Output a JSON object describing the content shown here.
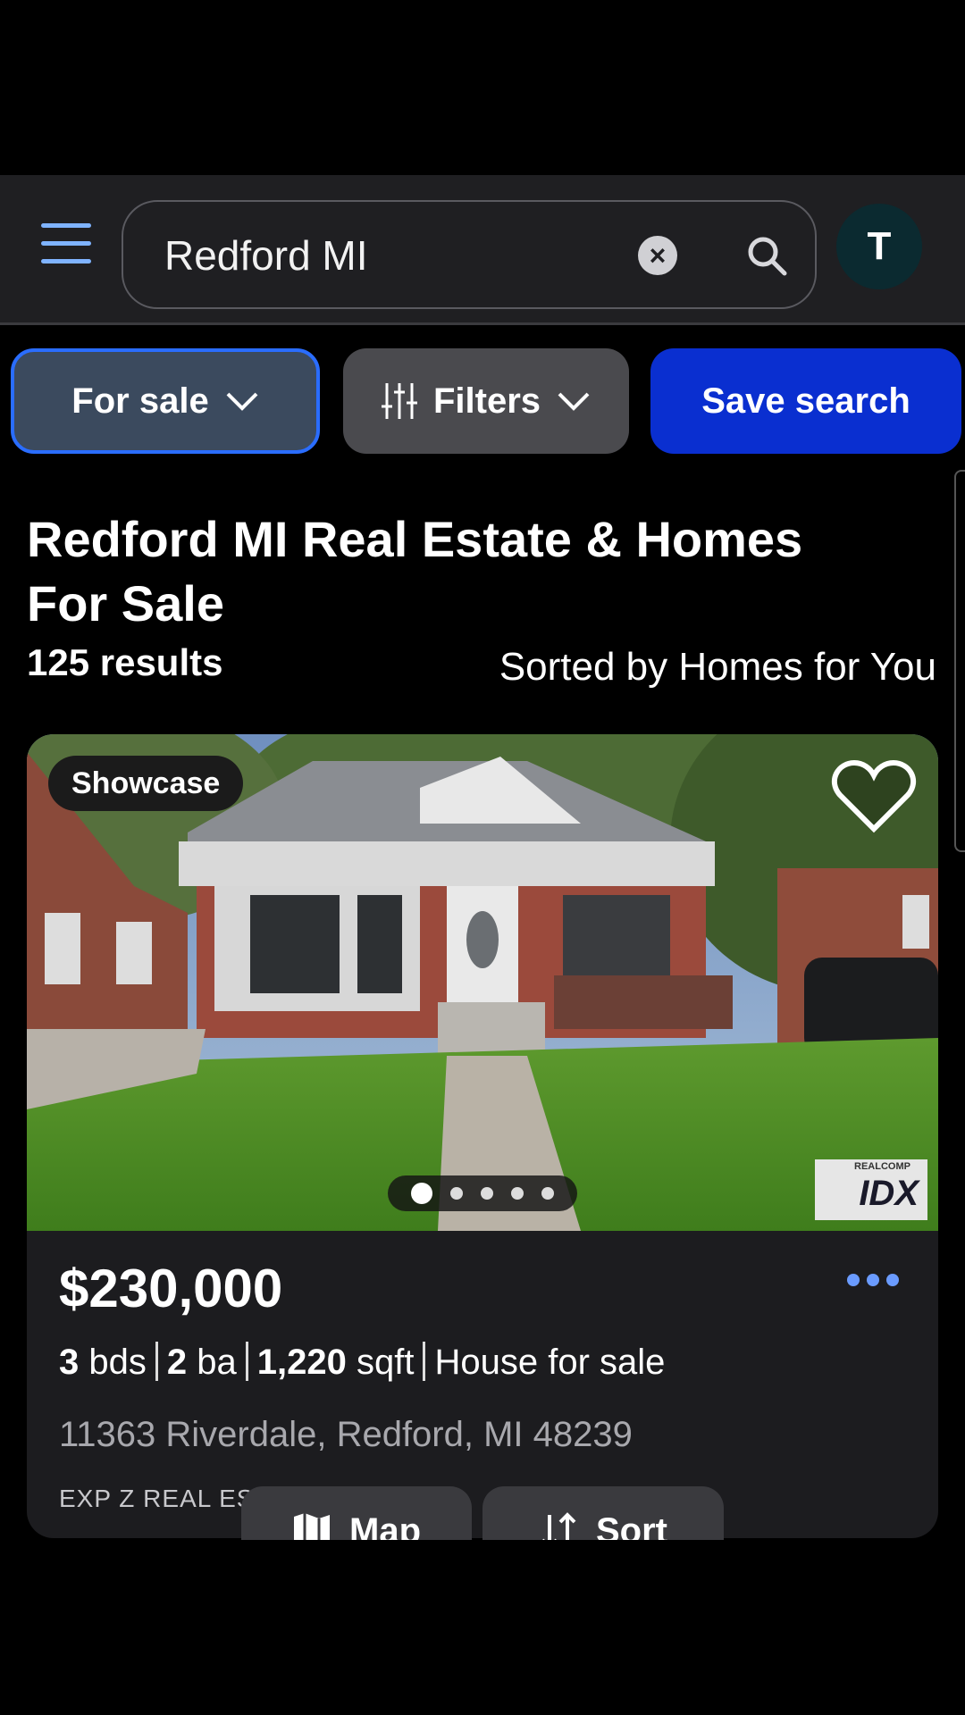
{
  "search": {
    "value": "Redford MI",
    "clear_icon": "close-icon",
    "search_icon": "search-icon"
  },
  "user": {
    "avatar_initial": "T"
  },
  "chips": {
    "for_sale": "For sale",
    "filters": "Filters",
    "save_search": "Save search"
  },
  "header": {
    "title_line1": "Redford MI Real Estate & Homes",
    "title_line2": "For Sale",
    "results": "125 results",
    "sorted": "Sorted by Homes for You"
  },
  "listing": {
    "badge": "Showcase",
    "price": "$230,000",
    "beds": "3",
    "beds_unit": "bds",
    "baths": "2",
    "baths_unit": "ba",
    "sqft": "1,220",
    "sqft_unit": "sqft",
    "type": "House for sale",
    "address": "11363 Riverdale, Redford, MI 48239",
    "broker": "EXP Z REAL ESTATE",
    "photo_count": 5,
    "active_photo": 1,
    "idx_label": "IDX",
    "idx_small": "REALCOMP"
  },
  "floating": {
    "map": "Map",
    "sort": "Sort"
  },
  "colors": {
    "accent": "#2a6dff",
    "save_button": "#0a2fd0",
    "link_dots": "#6a9bff"
  }
}
